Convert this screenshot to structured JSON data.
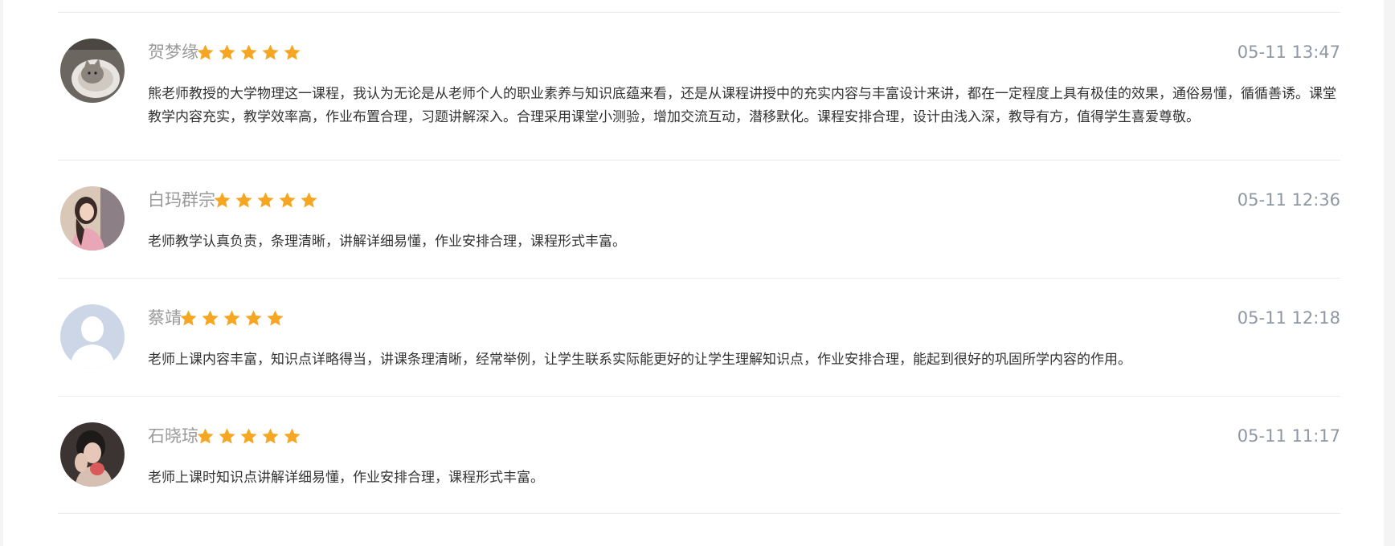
{
  "reviews": [
    {
      "name": "贺梦缘",
      "time": "05-11 13:47",
      "rating": 5,
      "avatar": "cat-photo-avatar",
      "content": "熊老师教授的大学物理这一课程，我认为无论是从老师个人的职业素养与知识底蕴来看，还是从课程讲授中的充实内容与丰富设计来讲，都在一定程度上具有极佳的效果，通俗易懂，循循善诱。课堂教学内容充实，教学效率高，作业布置合理，习题讲解深入。合理采用课堂小测验，增加交流互动，潜移默化。课程安排合理，设计由浅入深，教导有方，值得学生喜爱尊敬。"
    },
    {
      "name": "白玛群宗",
      "time": "05-11 12:36",
      "rating": 5,
      "avatar": "girl-photo-avatar",
      "content": "老师教学认真负责，条理清晰，讲解详细易懂，作业安排合理，课程形式丰富。"
    },
    {
      "name": "蔡靖",
      "time": "05-11 12:18",
      "rating": 5,
      "avatar": "default-user-avatar",
      "content": "老师上课内容丰富，知识点详略得当，讲课条理清晰，经常举例，让学生联系实际能更好的让学生理解知识点，作业安排合理，能起到很好的巩固所学内容的作用。"
    },
    {
      "name": "石晓琼",
      "time": "05-11 11:17",
      "rating": 5,
      "avatar": "photo-avatar",
      "content": "老师上课时知识点讲解详细易懂，作业安排合理，课程形式丰富。"
    }
  ],
  "colors": {
    "star": "#f5a623",
    "name": "#9a9a9a",
    "time": "#8f97a3",
    "text": "#333333",
    "divider": "#ececec"
  }
}
